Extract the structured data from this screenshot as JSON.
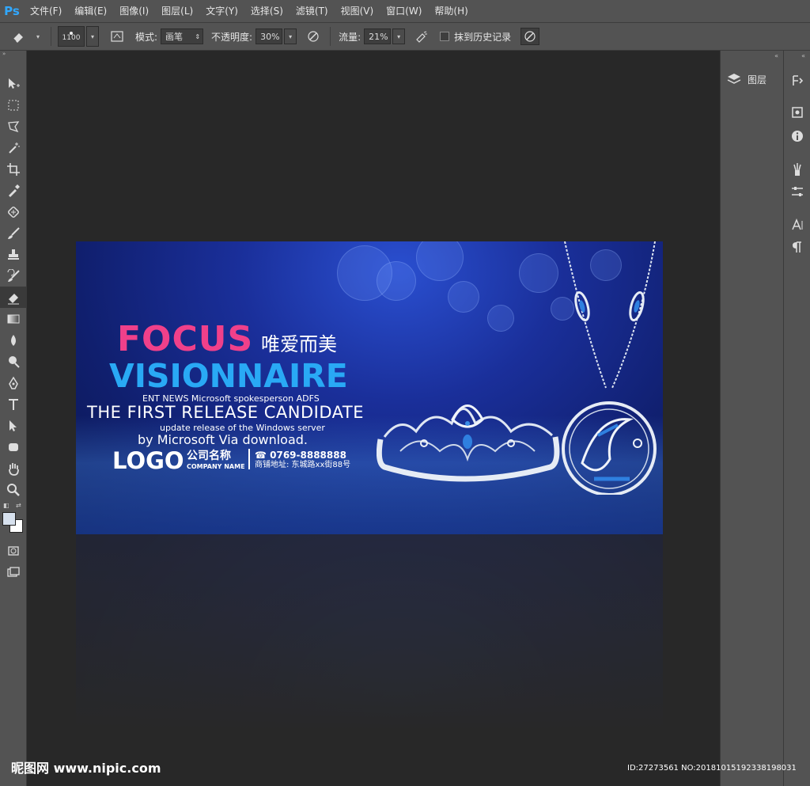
{
  "app": {
    "logo": "Ps"
  },
  "menu": [
    "文件(F)",
    "编辑(E)",
    "图像(I)",
    "图层(L)",
    "文字(Y)",
    "选择(S)",
    "滤镜(T)",
    "视图(V)",
    "窗口(W)",
    "帮助(H)"
  ],
  "options": {
    "brush_size": "1100",
    "mode_label": "模式:",
    "mode_value": "画笔",
    "opacity_label": "不透明度:",
    "opacity_value": "30%",
    "flow_label": "流量:",
    "flow_value": "21%",
    "history_label": "抹到历史记录"
  },
  "panels": {
    "layers_label": "图层"
  },
  "banner": {
    "focus": "FOCUS",
    "cn_title": "唯爱而美",
    "visionnaire": "VISIONNAIRE",
    "news": "ENT NEWS Microsoft spokesperson ADFS",
    "first_release": "THE FIRST RELEASE CANDIDATE",
    "update": "update release of the Windows server",
    "by_line": "by Microsoft Via download.",
    "logo": "LOGO",
    "company_cn": "公司名称",
    "company_en": "COMPANY NAME",
    "phone": "☎ 0769-8888888",
    "address": "商铺地址: 东城路xx街88号"
  },
  "watermark": {
    "site": "昵图网 www.nipic.com",
    "id": "ID:27273561 NO:20181015192338198031"
  },
  "colors": {
    "accent_pink": "#f0408a",
    "accent_cyan": "#29a9f5",
    "ui_panel": "#535353",
    "ui_canvas": "#282828"
  }
}
